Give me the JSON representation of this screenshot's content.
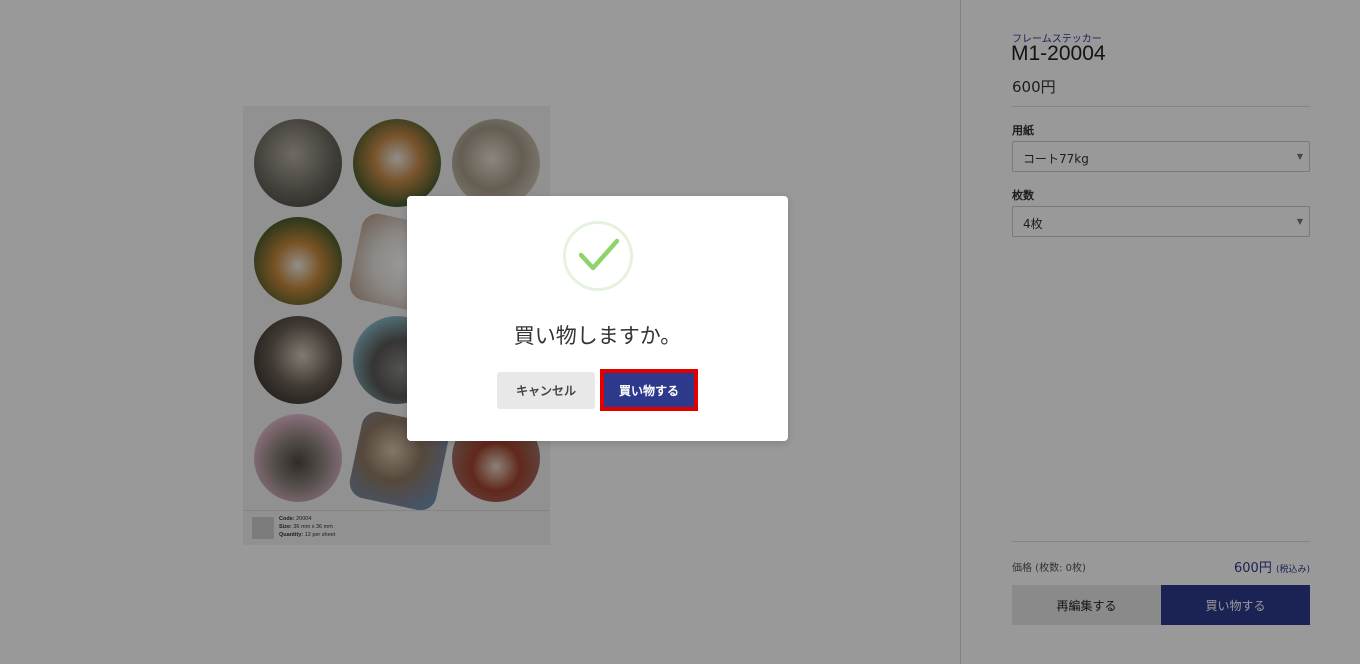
{
  "product": {
    "category": "フレームステッカー",
    "code": "M1-20004",
    "price": "600円"
  },
  "options": {
    "paper_label": "用紙",
    "paper_value": "コート77kg",
    "quantity_label": "枚数",
    "quantity_value": "4枚"
  },
  "summary": {
    "total_label": "価格 (枚数: 0枚)",
    "total_value": "600円",
    "tax_note": "(税込み)"
  },
  "actions": {
    "reedit_label": "再編集する",
    "buy_label": "買い物する"
  },
  "sheet": {
    "code_label": "Code:",
    "code_value": "20004",
    "size_label": "Size:",
    "size_value": "36 mm x 36 mm",
    "quantity_label": "Quantity:",
    "quantity_value": "12 per sheet"
  },
  "modal": {
    "icon": "check-icon",
    "title": "買い物しますか。",
    "cancel_label": "キャンセル",
    "confirm_label": "買い物する"
  },
  "colors": {
    "brand": "#2d3a8c",
    "highlight": "#e00000",
    "check": "#8fd36b"
  }
}
